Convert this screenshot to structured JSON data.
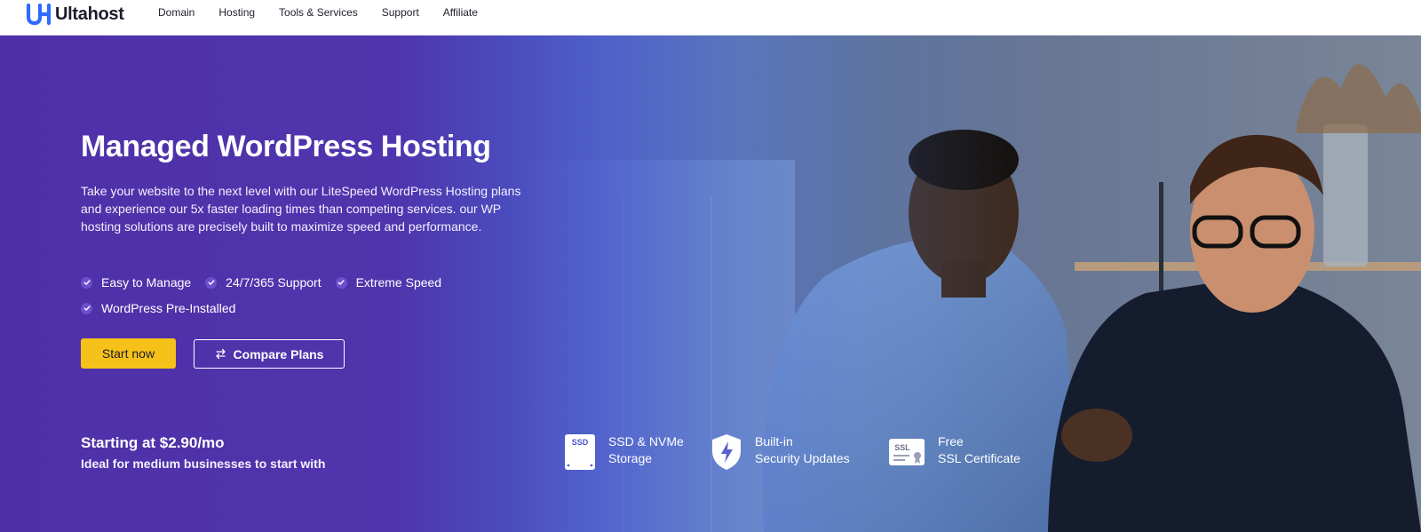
{
  "brand": {
    "logo_text": "Ultahost",
    "colors": {
      "logo_blue": "#2f6bff",
      "hero_purple": "#4f30a8",
      "accent_yellow": "#f6c21a"
    }
  },
  "nav": {
    "links": [
      "Domain",
      "Hosting",
      "Tools & Services",
      "Support",
      "Affiliate"
    ]
  },
  "hero": {
    "title": "Managed WordPress Hosting",
    "description": "Take your website to the next level with our LiteSpeed WordPress Hosting plans and experience our 5x faster loading times than competing services. our WP hosting solutions are precisely built to maximize speed and performance.",
    "features": [
      "Easy to Manage",
      "24/7/365 Support",
      "Extreme Speed",
      "WordPress Pre-Installed"
    ],
    "primary_button": "Start now",
    "secondary_button": "Compare Plans",
    "price_title": "Starting at $2.90/mo",
    "price_subtitle": "Ideal for medium businesses to start with"
  },
  "badges": [
    {
      "icon": "ssd-icon",
      "icon_label": "SSD",
      "line1": "SSD & NVMe",
      "line2": "Storage"
    },
    {
      "icon": "shield-bolt-icon",
      "line1": "Built-in",
      "line2": "Security Updates"
    },
    {
      "icon": "ssl-certificate-icon",
      "icon_label": "SSL",
      "line1": "Free",
      "line2": "SSL Certificate"
    }
  ]
}
